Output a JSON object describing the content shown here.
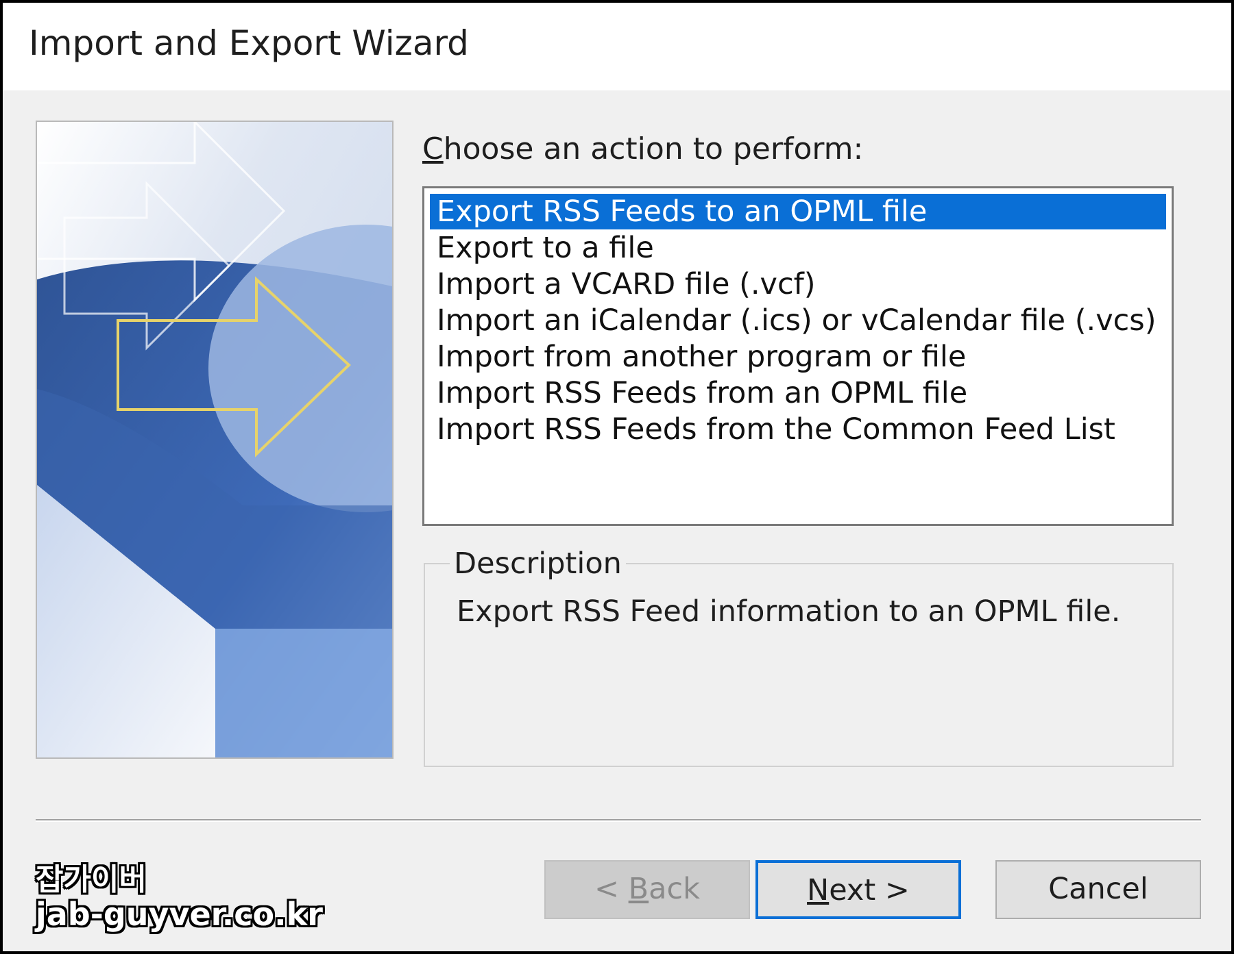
{
  "window": {
    "title": "Import and Export Wizard"
  },
  "prompt": {
    "prefix": "C",
    "rest": "hoose an action to perform:"
  },
  "list": {
    "items": [
      "Export RSS Feeds to an OPML file",
      "Export to a file",
      "Import a VCARD file (.vcf)",
      "Import an iCalendar (.ics) or vCalendar file (.vcs)",
      "Import from another program or file",
      "Import RSS Feeds from an OPML file",
      "Import RSS Feeds from the Common Feed List"
    ],
    "selected_index": 0
  },
  "description": {
    "label": "Description",
    "text": "Export RSS Feed information to an OPML file."
  },
  "buttons": {
    "back": {
      "pre": "< ",
      "key": "B",
      "rest": "ack",
      "enabled": false
    },
    "next": {
      "key": "N",
      "rest": "ext >"
    },
    "cancel": {
      "label": "Cancel"
    }
  },
  "watermark": {
    "line1": "잡가이버",
    "line2": "jab-guyver.co.kr"
  },
  "colors": {
    "selection": "#0a6fd6",
    "dialog_bg": "#f0f0f0",
    "focus_border": "#0a6fd6"
  }
}
